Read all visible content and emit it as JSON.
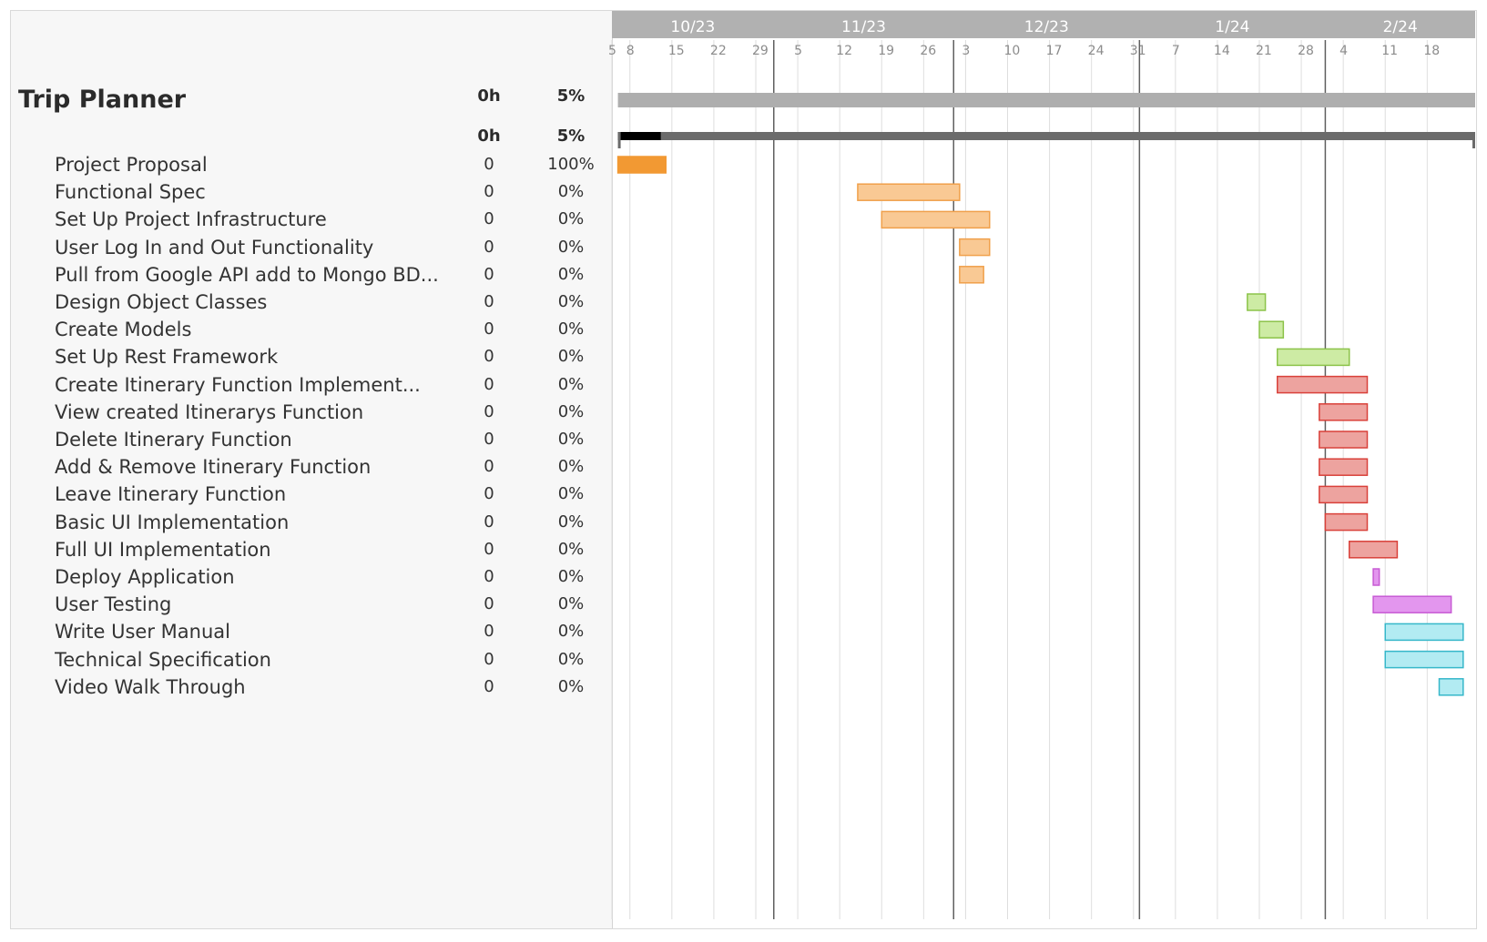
{
  "chart_data": {
    "type": "gantt",
    "title": "Trip Planner",
    "summary": {
      "hours": "0h",
      "percent": "5%"
    },
    "subgroup": {
      "hours": "0h",
      "percent": "5%"
    },
    "timeline": {
      "start": "2023-10-05",
      "end": "2024-02-26",
      "months": [
        {
          "label": "10/23",
          "date": "2023-10-01"
        },
        {
          "label": "11/23",
          "date": "2023-11-01"
        },
        {
          "label": "12/23",
          "date": "2023-12-01"
        },
        {
          "label": "1/24",
          "date": "2024-01-01"
        },
        {
          "label": "2/24",
          "date": "2024-02-01"
        }
      ],
      "weeks": [
        {
          "label": "5",
          "date": "2023-10-05"
        },
        {
          "label": "8",
          "date": "2023-10-08"
        },
        {
          "label": "15",
          "date": "2023-10-15"
        },
        {
          "label": "22",
          "date": "2023-10-22"
        },
        {
          "label": "29",
          "date": "2023-10-29"
        },
        {
          "label": "5",
          "date": "2023-11-05"
        },
        {
          "label": "12",
          "date": "2023-11-12"
        },
        {
          "label": "19",
          "date": "2023-11-19"
        },
        {
          "label": "26",
          "date": "2023-11-26"
        },
        {
          "label": "3",
          "date": "2023-12-03"
        },
        {
          "label": "10",
          "date": "2023-12-10"
        },
        {
          "label": "17",
          "date": "2023-12-17"
        },
        {
          "label": "24",
          "date": "2023-12-24"
        },
        {
          "label": "31",
          "date": "2023-12-31"
        },
        {
          "label": "7",
          "date": "2024-01-07"
        },
        {
          "label": "14",
          "date": "2024-01-14"
        },
        {
          "label": "21",
          "date": "2024-01-21"
        },
        {
          "label": "28",
          "date": "2024-01-28"
        },
        {
          "label": "4",
          "date": "2024-02-04"
        },
        {
          "label": "11",
          "date": "2024-02-11"
        },
        {
          "label": "18",
          "date": "2024-02-18"
        }
      ]
    },
    "project_bar": {
      "start": "2023-10-06",
      "end": "2024-02-26",
      "progress": 0.05
    },
    "tasks": [
      {
        "name": "Project Proposal",
        "hours": "0",
        "percent": "100%",
        "start": "2023-10-06",
        "end": "2023-10-14",
        "group": "orange-done"
      },
      {
        "name": "Functional Spec",
        "hours": "0",
        "percent": "0%",
        "start": "2023-11-15",
        "end": "2023-12-02",
        "group": "orange"
      },
      {
        "name": "Set Up Project Infrastructure",
        "hours": "0",
        "percent": "0%",
        "start": "2023-11-19",
        "end": "2023-12-07",
        "group": "orange"
      },
      {
        "name": "User Log In and Out Functionality",
        "hours": "0",
        "percent": "0%",
        "start": "2023-12-02",
        "end": "2023-12-07",
        "group": "orange"
      },
      {
        "name": "Pull from Google API add to Mongo BD...",
        "hours": "0",
        "percent": "0%",
        "start": "2023-12-02",
        "end": "2023-12-06",
        "group": "orange"
      },
      {
        "name": "Design Object Classes",
        "hours": "0",
        "percent": "0%",
        "start": "2024-01-19",
        "end": "2024-01-22",
        "group": "green"
      },
      {
        "name": "Create Models",
        "hours": "0",
        "percent": "0%",
        "start": "2024-01-21",
        "end": "2024-01-25",
        "group": "green"
      },
      {
        "name": "Set Up Rest Framework",
        "hours": "0",
        "percent": "0%",
        "start": "2024-01-24",
        "end": "2024-02-05",
        "group": "green"
      },
      {
        "name": "Create Itinerary Function Implement...",
        "hours": "0",
        "percent": "0%",
        "start": "2024-01-24",
        "end": "2024-02-08",
        "group": "red"
      },
      {
        "name": "View created Itinerarys Function",
        "hours": "0",
        "percent": "0%",
        "start": "2024-01-31",
        "end": "2024-02-08",
        "group": "red"
      },
      {
        "name": "Delete Itinerary Function",
        "hours": "0",
        "percent": "0%",
        "start": "2024-01-31",
        "end": "2024-02-08",
        "group": "red"
      },
      {
        "name": "Add & Remove Itinerary Function",
        "hours": "0",
        "percent": "0%",
        "start": "2024-01-31",
        "end": "2024-02-08",
        "group": "red"
      },
      {
        "name": "Leave Itinerary Function",
        "hours": "0",
        "percent": "0%",
        "start": "2024-01-31",
        "end": "2024-02-08",
        "group": "red"
      },
      {
        "name": "Basic UI Implementation",
        "hours": "0",
        "percent": "0%",
        "start": "2024-02-01",
        "end": "2024-02-08",
        "group": "red"
      },
      {
        "name": "Full UI Implementation",
        "hours": "0",
        "percent": "0%",
        "start": "2024-02-05",
        "end": "2024-02-13",
        "group": "red"
      },
      {
        "name": "Deploy Application",
        "hours": "0",
        "percent": "0%",
        "start": "2024-02-09",
        "end": "2024-02-10",
        "group": "purple"
      },
      {
        "name": "User Testing",
        "hours": "0",
        "percent": "0%",
        "start": "2024-02-09",
        "end": "2024-02-22",
        "group": "purple"
      },
      {
        "name": "Write User Manual",
        "hours": "0",
        "percent": "0%",
        "start": "2024-02-11",
        "end": "2024-02-24",
        "group": "cyan"
      },
      {
        "name": "Technical Specification",
        "hours": "0",
        "percent": "0%",
        "start": "2024-02-11",
        "end": "2024-02-24",
        "group": "cyan"
      },
      {
        "name": "Video Walk Through",
        "hours": "0",
        "percent": "0%",
        "start": "2024-02-20",
        "end": "2024-02-24",
        "group": "cyan"
      }
    ],
    "group_colors": {
      "orange-done": {
        "fill": "#f29933",
        "stroke": "#f29933"
      },
      "orange": {
        "fill": "#f9c994",
        "stroke": "#f0a04b"
      },
      "green": {
        "fill": "#cdeba4",
        "stroke": "#8cc34a"
      },
      "red": {
        "fill": "#eda39f",
        "stroke": "#d9413a"
      },
      "purple": {
        "fill": "#e396ee",
        "stroke": "#c75bd4"
      },
      "cyan": {
        "fill": "#b2ebf2",
        "stroke": "#36b7c9"
      }
    },
    "colors": {
      "header_bg": "#b1b1b1",
      "project_bar": "#aeaeae",
      "subgroup_bar": "#6b6b6b",
      "subgroup_progress": "#000000"
    }
  }
}
